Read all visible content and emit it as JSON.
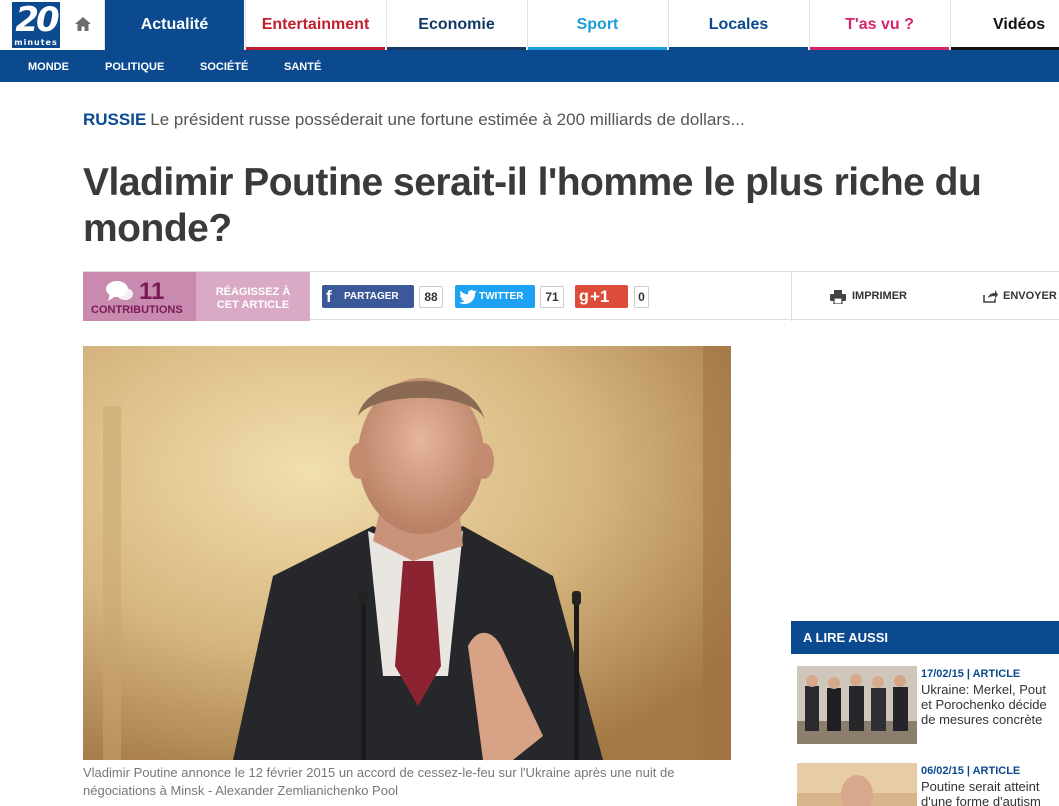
{
  "site": {
    "logo_number": "20",
    "logo_sub": "minutes"
  },
  "nav": {
    "tabs": [
      {
        "label": "Actualité",
        "color": "#0b4a8f"
      },
      {
        "label": "Entertainment",
        "color": "#c0202e"
      },
      {
        "label": "Economie",
        "color": "#123a66"
      },
      {
        "label": "Sport",
        "color": "#1c9ed9"
      },
      {
        "label": "Locales",
        "color": "#0b4a8f"
      },
      {
        "label": "T'as vu ?",
        "color": "#d6246e"
      },
      {
        "label": "Vidéos",
        "color": "#111111"
      }
    ],
    "sub": [
      "MONDE",
      "POLITIQUE",
      "SOCIÉTÉ",
      "SANTÉ"
    ]
  },
  "article": {
    "category": "RUSSIE",
    "summary": "Le président russe posséderait une fortune estimée à 200 milliards de dollars...",
    "title": "Vladimir Poutine serait-il l'homme le plus riche du monde?",
    "caption": "Vladimir Poutine annonce le 12 février 2015 un accord de cessez-le-feu sur l'Ukraine après une nuit de négociations à Minsk - Alexander Zemlianichenko Pool"
  },
  "share": {
    "contributions_count": "11",
    "contributions_label": "CONTRIBUTIONS",
    "react_label_1": "RÉAGISSEZ À",
    "react_label_2": "CET ARTICLE",
    "facebook_label": "PARTAGER",
    "facebook_count": "88",
    "twitter_label": "TWITTER",
    "twitter_count": "71",
    "gplus_label": "+1",
    "gplus_count": "0",
    "print_label": "IMPRIMER",
    "send_label": "ENVOYER",
    "colors": {
      "facebook": "#3b5998",
      "twitter": "#1da1f2",
      "gplus": "#dd4b39"
    }
  },
  "aside": {
    "heading": "A LIRE AUSSI",
    "items": [
      {
        "meta": "17/02/15 | ARTICLE",
        "title_1": "Ukraine: Merkel, Pout",
        "title_2": "et Porochenko décide",
        "title_3": "de mesures concrète"
      },
      {
        "meta": "06/02/15 | ARTICLE",
        "title_1": "Poutine serait atteint",
        "title_2": "d'une forme d'autism"
      }
    ]
  }
}
